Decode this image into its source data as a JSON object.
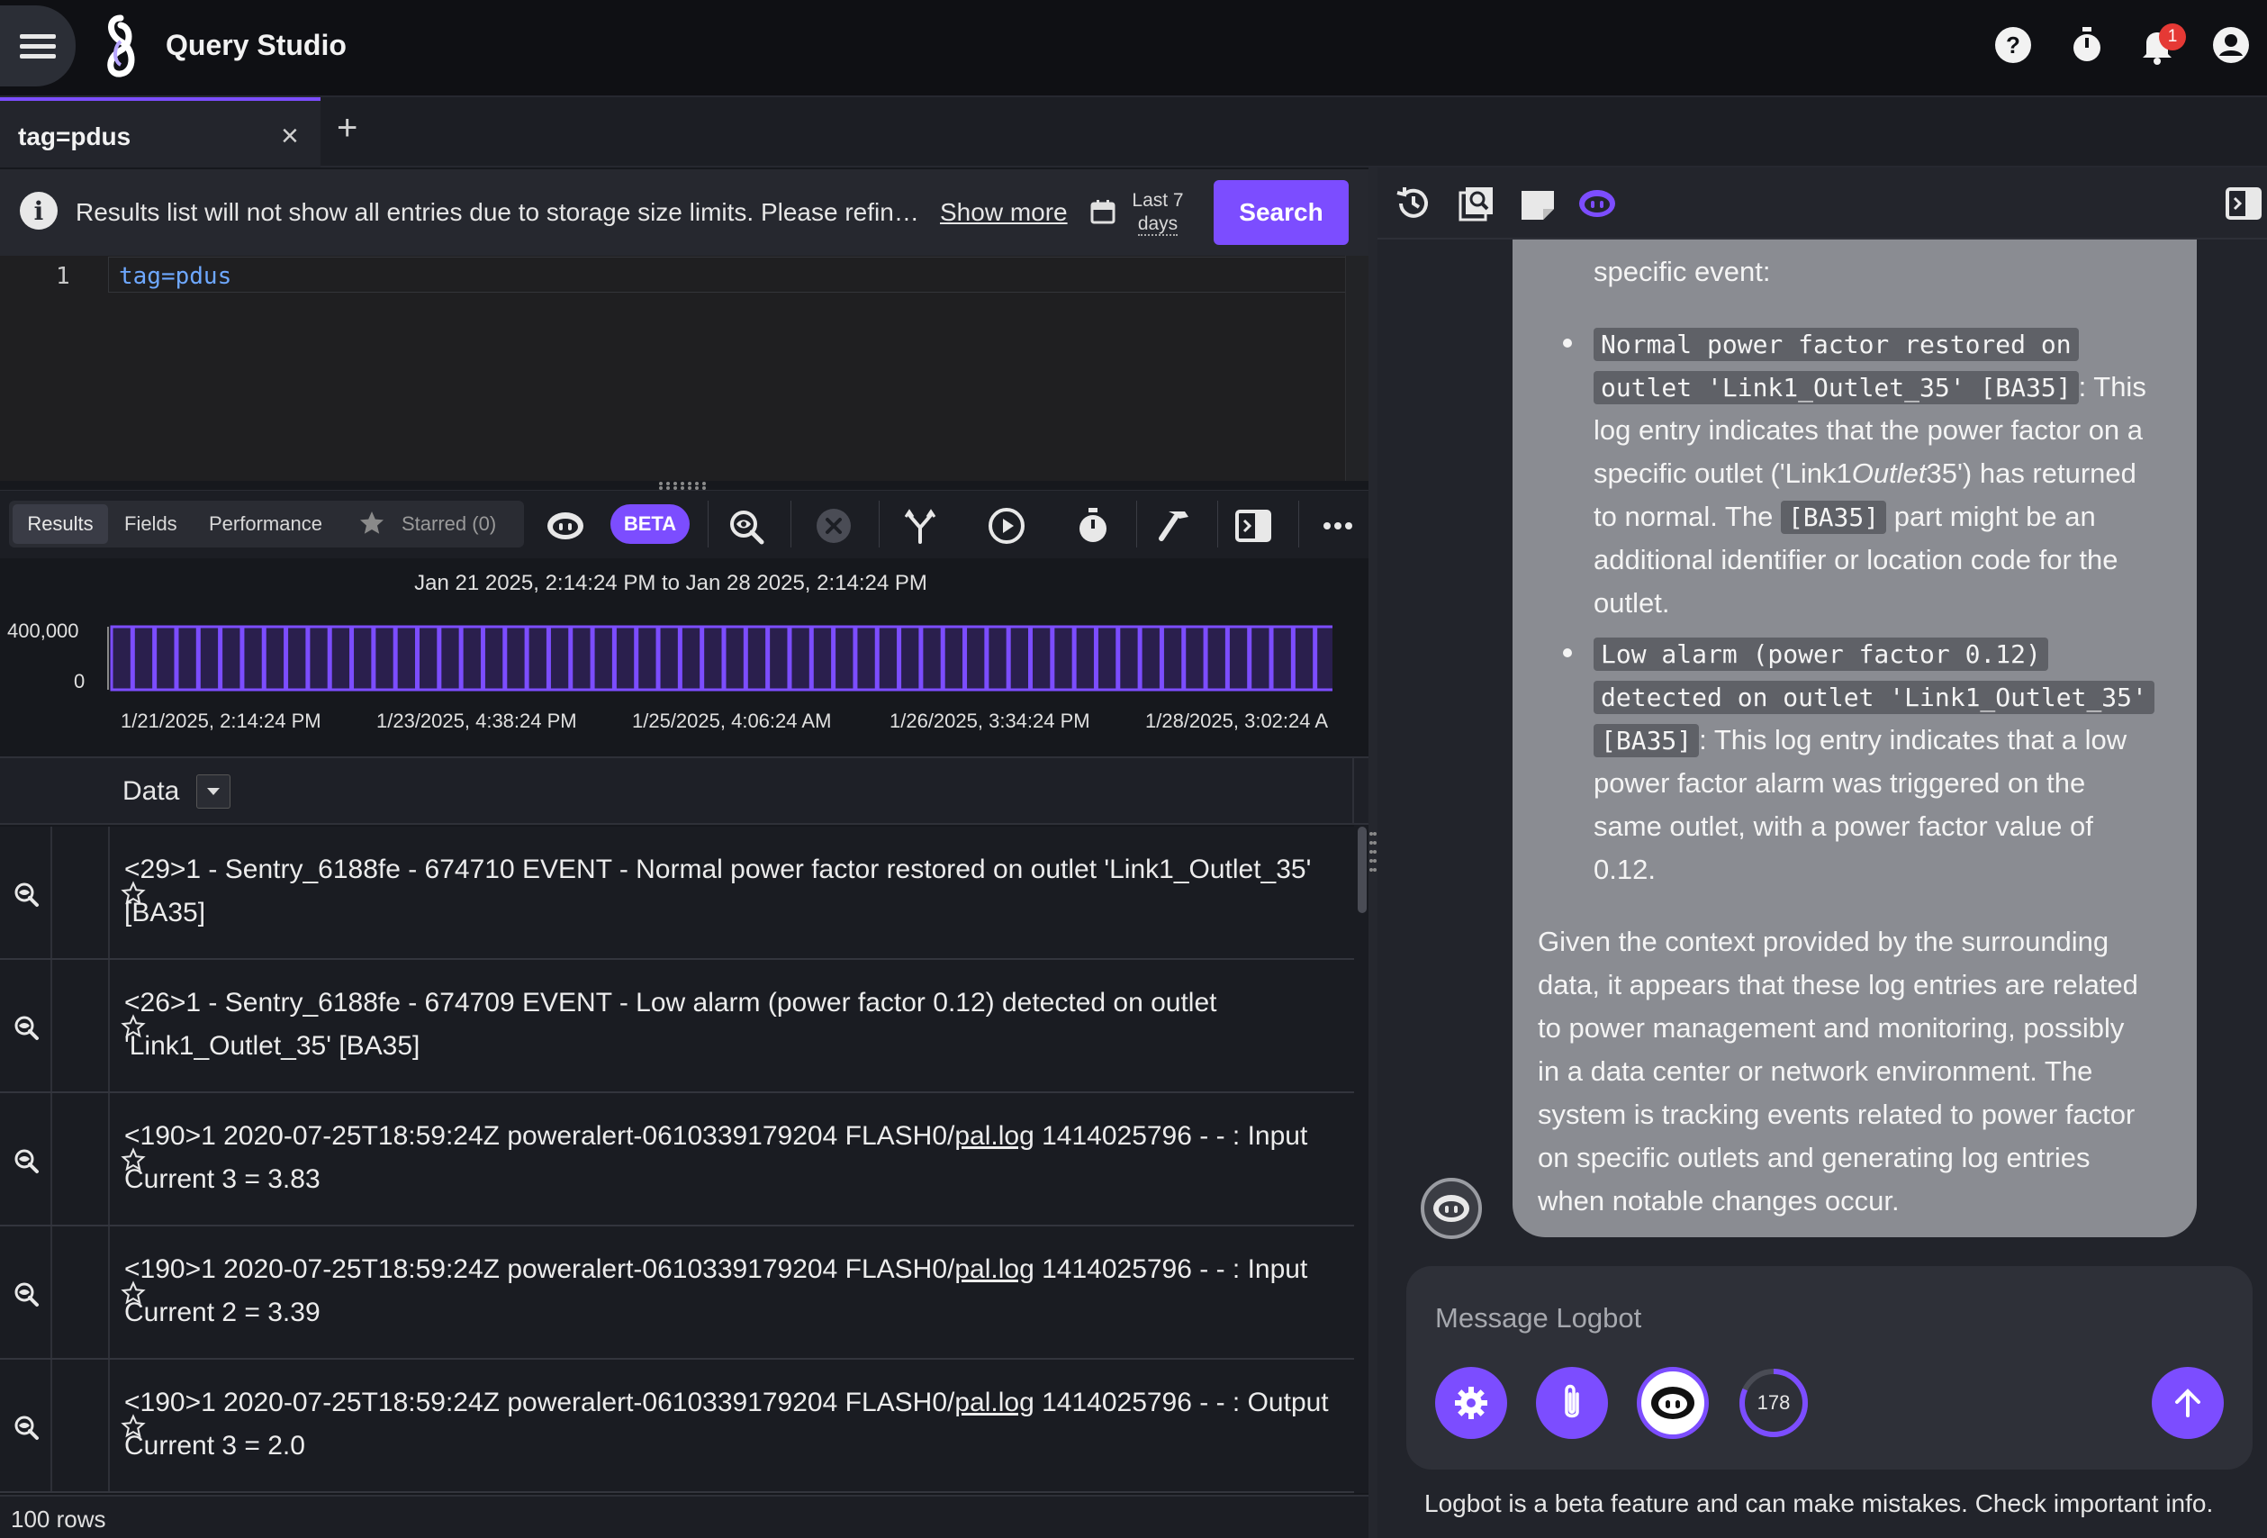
{
  "app": {
    "title": "Query Studio"
  },
  "header": {
    "notification_count": "1",
    "icons": [
      "help-icon",
      "timer-icon",
      "bell-icon",
      "account-icon"
    ]
  },
  "tabs": {
    "active_label": "tag=pdus"
  },
  "notice": {
    "text": "Results list will not show all entries due to storage size limits. Please refin…",
    "show_more": "Show more"
  },
  "time_range": {
    "line1": "Last 7",
    "line2": "days"
  },
  "search": {
    "label": "Search"
  },
  "editor": {
    "line_number": "1",
    "query": "tag=pdus"
  },
  "results_tabs": {
    "results": "Results",
    "fields": "Fields",
    "performance": "Performance",
    "starred": "Starred (0)"
  },
  "toolbar": {
    "beta": "BETA"
  },
  "chart_data": {
    "type": "bar",
    "title": "Jan 21 2025, 2:14:24 PM to Jan 28 2025, 2:14:24 PM",
    "xlabel": "",
    "ylabel": "",
    "ylim": [
      0,
      400000
    ],
    "y_ticks": [
      "400,000",
      "0"
    ],
    "x_ticks": [
      "1/21/2025, 2:14:24 PM",
      "1/23/2025, 4:38:24 PM",
      "1/25/2025, 4:06:24 AM",
      "1/26/2025, 3:34:24 PM",
      "1/28/2025, 3:02:24 A"
    ],
    "bar_count": 56,
    "values": [
      400000,
      400000,
      400000,
      400000,
      400000,
      400000,
      400000,
      400000,
      400000,
      400000,
      400000,
      400000,
      400000,
      400000,
      400000,
      400000,
      400000,
      400000,
      400000,
      400000,
      400000,
      400000,
      400000,
      400000,
      400000,
      400000,
      400000,
      400000,
      400000,
      400000,
      400000,
      400000,
      400000,
      400000,
      400000,
      400000,
      400000,
      400000,
      400000,
      400000,
      400000,
      400000,
      400000,
      400000,
      400000,
      400000,
      400000,
      400000,
      400000,
      400000,
      400000,
      400000,
      400000,
      400000,
      400000,
      400000
    ],
    "bar_color": "#7c4dff"
  },
  "table": {
    "column": "Data",
    "rows": [
      {
        "pre": "<29>1 - Sentry_6188fe - 674710 EVENT - Normal power factor restored on outlet 'Link1_Outlet_35' [BA35]",
        "link": "",
        "post": ""
      },
      {
        "pre": "<26>1 - Sentry_6188fe - 674709 EVENT - Low alarm (power factor 0.12) detected on outlet 'Link1_Outlet_35' [BA35]",
        "link": "",
        "post": ""
      },
      {
        "pre": "<190>1 2020-07-25T18:59:24Z poweralert-0610339179204 FLASH0/",
        "link": "pal.log",
        "post": " 1414025796 - - : Input Current 3 = 3.83"
      },
      {
        "pre": "<190>1 2020-07-25T18:59:24Z poweralert-0610339179204 FLASH0/",
        "link": "pal.log",
        "post": " 1414025796 - - : Input Current 2 = 3.39"
      },
      {
        "pre": "<190>1 2020-07-25T18:59:24Z poweralert-0610339179204 FLASH0/",
        "link": "pal.log",
        "post": " 1414025796 - - : Output Current 3 = 2.0"
      }
    ],
    "row_count": "100 rows"
  },
  "chat": {
    "intro": "specific event:",
    "b1_code1": "Normal power factor restored on",
    "b1_code2": "outlet 'Link1_Outlet_35' [BA35]",
    "b1_t1": ": This",
    "b1_t2": "log entry indicates that the power factor on a",
    "b1_t3a": "specific outlet ('Link1",
    "b1_t3b": "Outlet",
    "b1_t3c": "35') has returned",
    "b1_t4a": "to normal. The",
    "b1_t4code": "[BA35]",
    "b1_t4b": "part might be an",
    "b1_t5": "additional identifier or location code for the",
    "b1_t6": "outlet.",
    "b2_code1": "Low alarm (power factor 0.12)",
    "b2_code2": "detected on outlet 'Link1_Outlet_35'",
    "b2_code3": "[BA35]",
    "b2_t1": ": This log entry indicates that a low",
    "b2_t2": "power factor alarm was triggered on the",
    "b2_t3": "same outlet, with a power factor value of",
    "b2_t4": "0.12.",
    "p1": "Given the context provided by the surrounding",
    "p2": "data, it appears that these log entries are related",
    "p3": "to power management and monitoring, possibly",
    "p4": "in a data center or network environment. The",
    "p5": "system is tracking events related to power factor",
    "p6": "on specific outlets and generating log entries",
    "p7": "when notable changes occur.",
    "placeholder": "Message Logbot",
    "usage": "178",
    "disclaimer": "Logbot is a beta feature and can make mistakes. Check important info."
  },
  "colors": {
    "accent": "#7c4dff",
    "bubble": "#8a8c92",
    "background": "#16181d"
  }
}
